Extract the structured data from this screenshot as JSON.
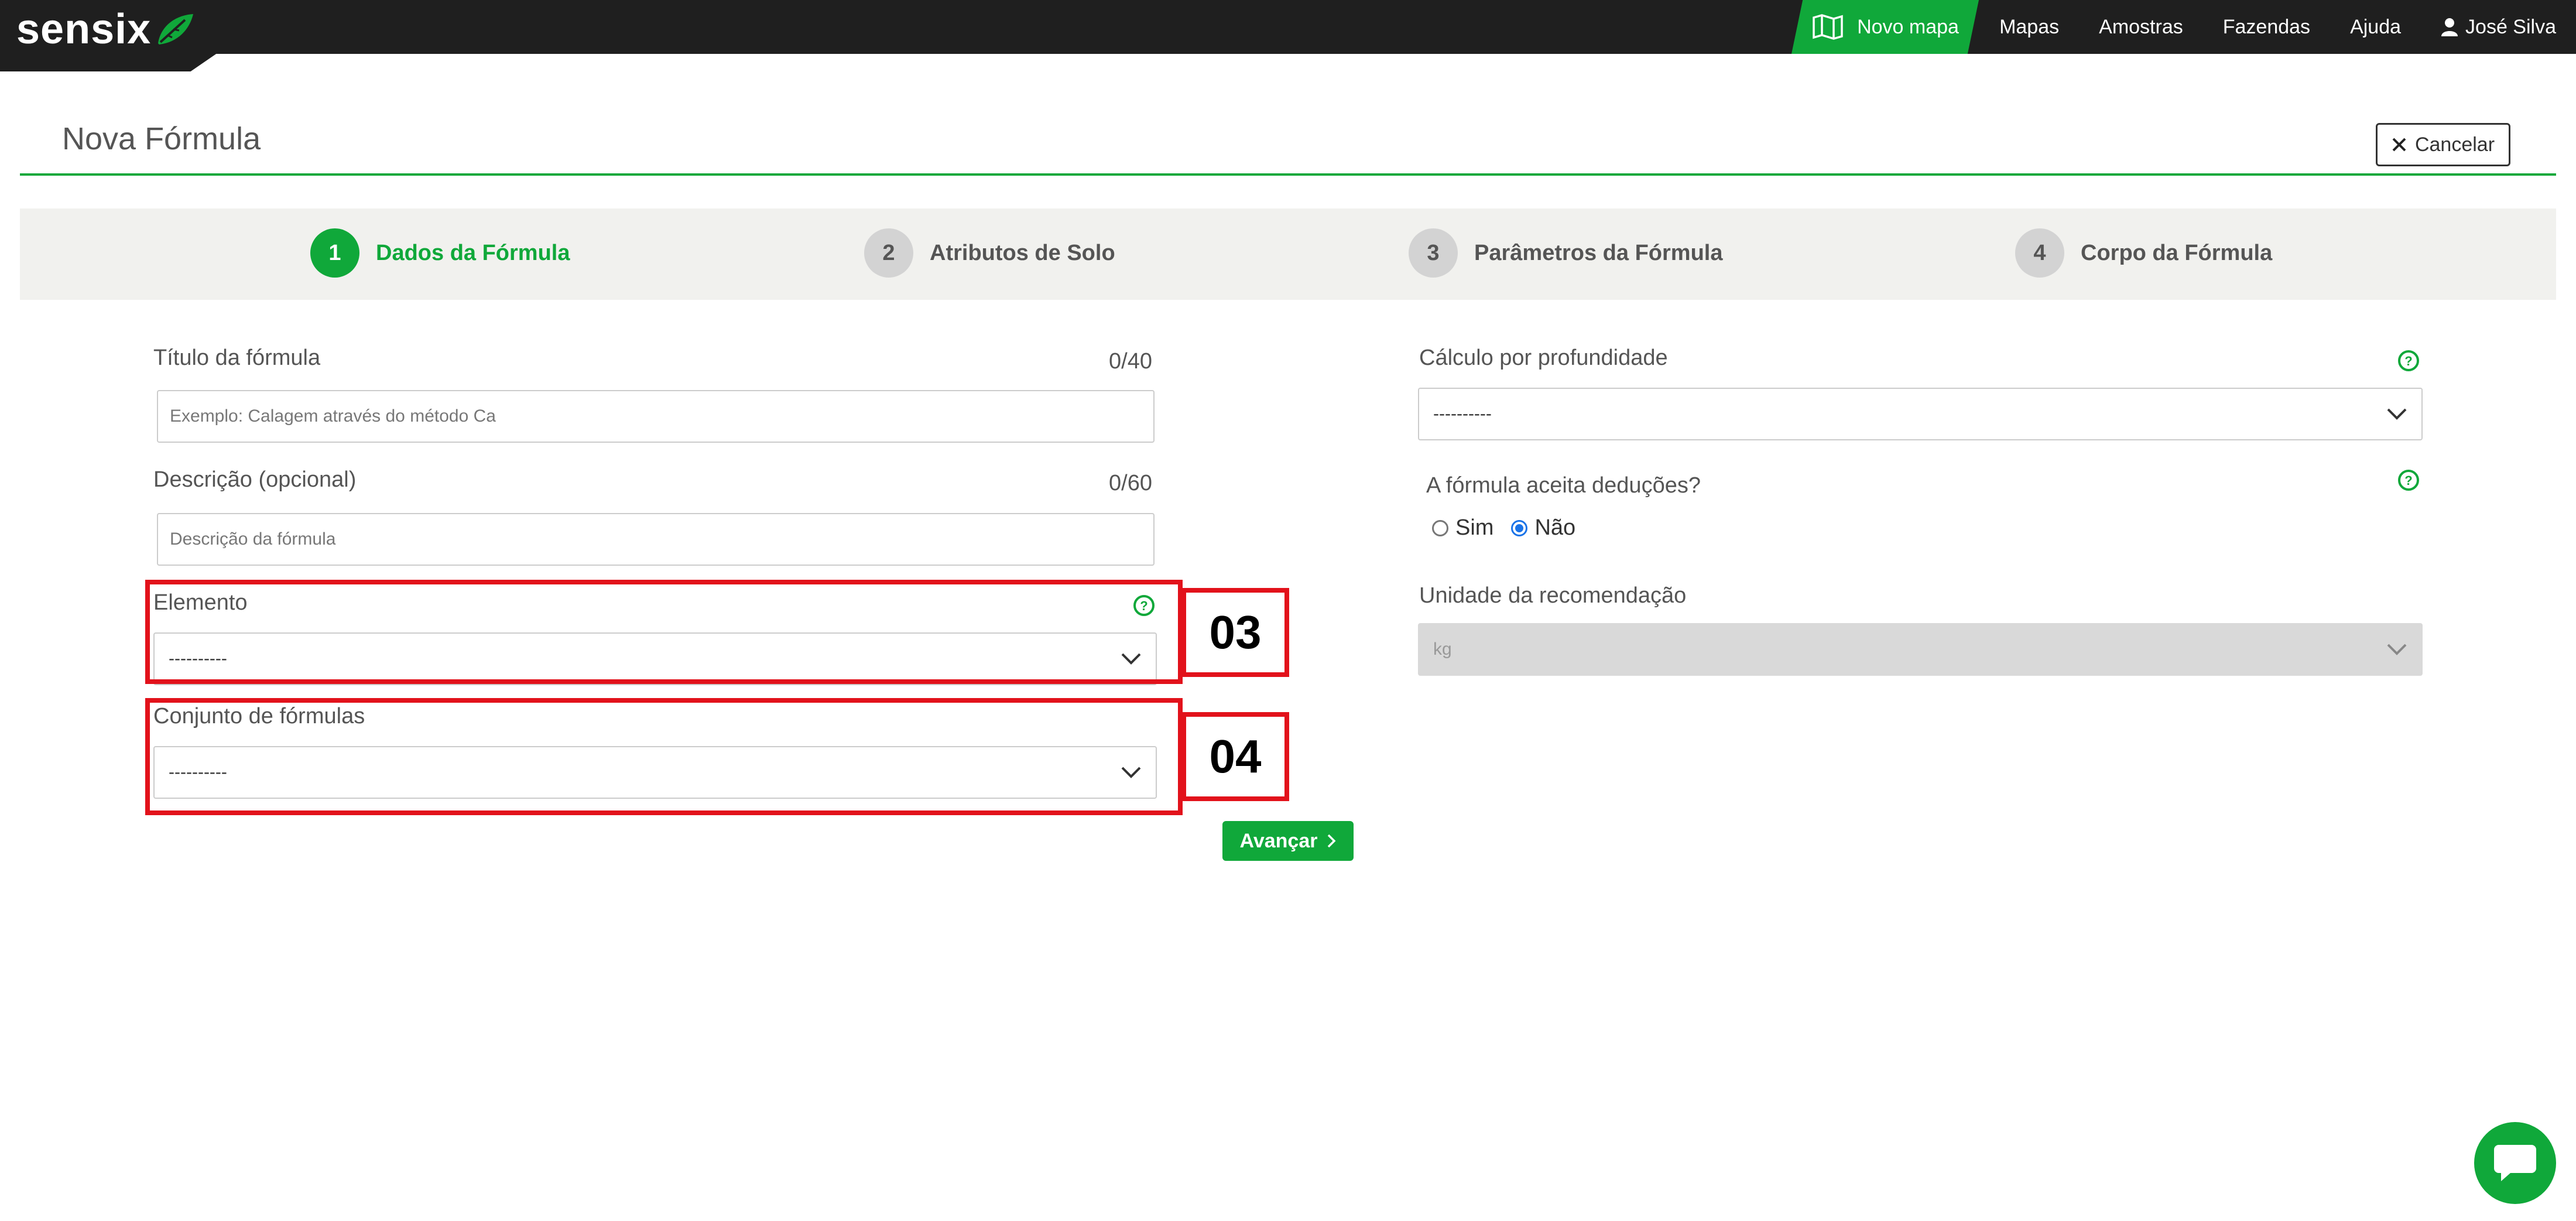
{
  "nav": {
    "logo": "sensix",
    "new_map": "Novo mapa",
    "items": [
      "Mapas",
      "Amostras",
      "Fazendas",
      "Ajuda"
    ],
    "user": "José Silva"
  },
  "page": {
    "title": "Nova Fórmula",
    "cancel": "Cancelar"
  },
  "steps": [
    {
      "number": "1",
      "label": "Dados da Fórmula"
    },
    {
      "number": "2",
      "label": "Atributos de Solo"
    },
    {
      "number": "3",
      "label": "Parâmetros da Fórmula"
    },
    {
      "number": "4",
      "label": "Corpo da Fórmula"
    }
  ],
  "form": {
    "title_label": "Título da fórmula",
    "title_counter": "0/40",
    "title_placeholder": "Exemplo: Calagem através do método Ca",
    "desc_label": "Descrição (opcional)",
    "desc_counter": "0/60",
    "desc_placeholder": "Descrição da fórmula",
    "element_label": "Elemento",
    "element_value": "----------",
    "set_label": "Conjunto de fórmulas",
    "set_value": "----------",
    "depth_label": "Cálculo por profundidade",
    "depth_value": "----------",
    "deductions_label": "A fórmula aceita deduções?",
    "yes": "Sim",
    "no": "Não",
    "unit_label": "Unidade da recomendação",
    "unit_value": "kg",
    "next": "Avançar"
  },
  "annotations": {
    "box3": "03",
    "box4": "04"
  },
  "colors": {
    "brand_green": "#10a83a",
    "highlight_red": "#e2121b",
    "navbar": "#1f1f1f"
  }
}
